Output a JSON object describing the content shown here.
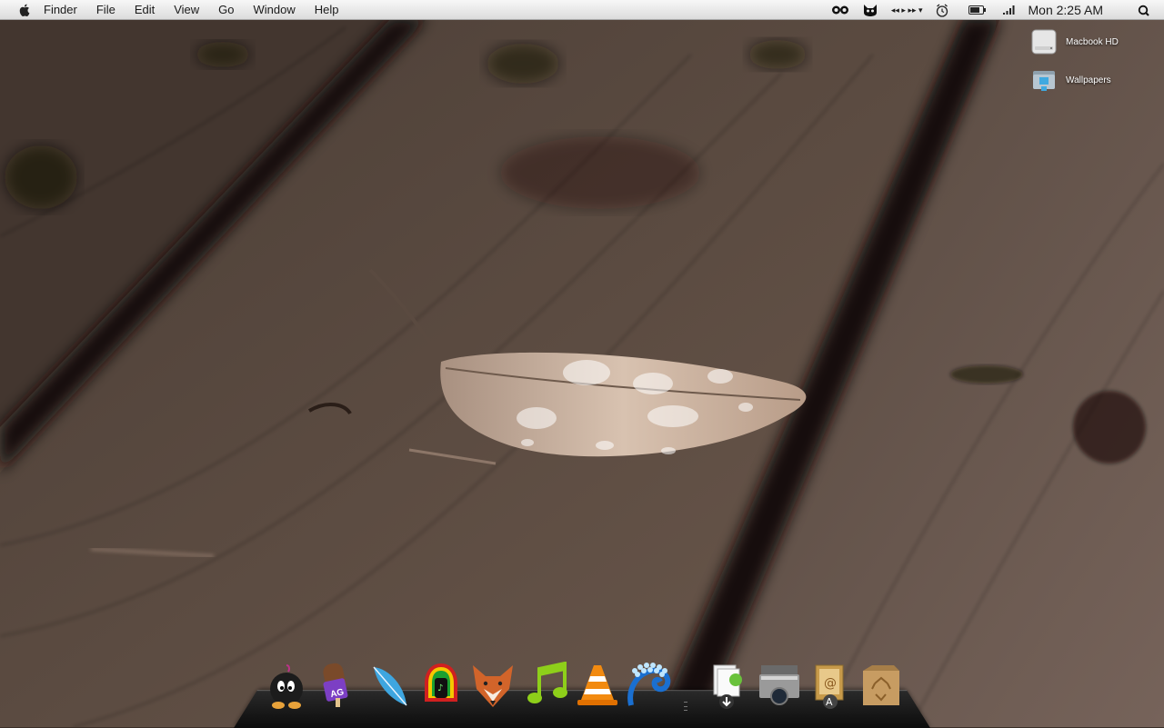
{
  "menubar": {
    "app_name": "Finder",
    "items": [
      "File",
      "Edit",
      "View",
      "Go",
      "Window",
      "Help"
    ],
    "clock": "Mon 2:25 AM",
    "status_icons": [
      "eyes-icon",
      "cat-icon",
      "media-controls-icon",
      "alarm-clock-icon",
      "battery-icon",
      "wifi-signal-icon"
    ],
    "media_controls_text": "◂◂ ▸ ▸▸ ▾"
  },
  "desktop": {
    "icons": [
      {
        "name": "macbook-hd-icon",
        "label": "Macbook HD"
      },
      {
        "name": "wallpapers-folder-icon",
        "label": "Wallpapers"
      }
    ]
  },
  "dock": {
    "apps": [
      {
        "name": "bomb-app-icon"
      },
      {
        "name": "popsicle-app-icon",
        "badge": "AG"
      },
      {
        "name": "feather-app-icon"
      },
      {
        "name": "music-helmet-app-icon"
      },
      {
        "name": "fox-app-icon"
      },
      {
        "name": "music-note-app-icon"
      },
      {
        "name": "vlc-cone-app-icon"
      },
      {
        "name": "wave-app-icon"
      }
    ],
    "utilities": [
      {
        "name": "downloads-stack-icon"
      },
      {
        "name": "printer-app-icon"
      },
      {
        "name": "mail-stamp-app-icon"
      },
      {
        "name": "trash-box-icon"
      }
    ]
  }
}
